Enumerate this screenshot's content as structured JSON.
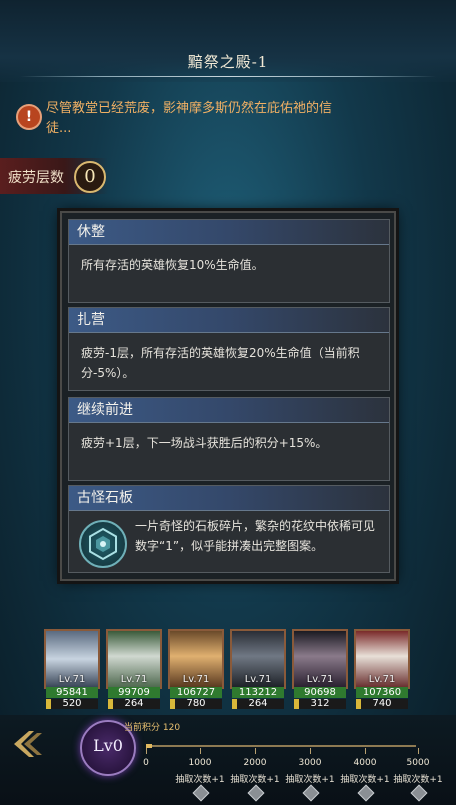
{
  "header": {
    "title": "黯祭之殿-1"
  },
  "notice": {
    "icon": "exclamation-icon",
    "text": "尽管教堂已经荒废，影神摩多斯仍然在庇佑祂的信徒..."
  },
  "fatigue": {
    "label": "疲劳层数",
    "value": "0"
  },
  "options": [
    {
      "title": "休整",
      "desc": "所有存活的英雄恢复10%生命值。"
    },
    {
      "title": "扎营",
      "desc": "疲劳-1层，所有存活的英雄恢复20%生命值（当前积分-5%）。"
    },
    {
      "title": "继续前进",
      "desc": "疲劳+1层，下一场战斗获胜后的积分+15%。"
    },
    {
      "title": "古怪石板",
      "desc": "一片奇怪的石板碎片，繁杂的花纹中依稀可见数字“1”，似乎能拼凑出完整图案。",
      "icon": "hexagon-rune-icon"
    }
  ],
  "heroes": [
    {
      "level": "Lv.71",
      "hp": "95841",
      "energy": "520",
      "energy_fraction": 0.1
    },
    {
      "level": "Lv.71",
      "hp": "99709",
      "energy": "264",
      "energy_fraction": 0.1
    },
    {
      "level": "Lv.71",
      "hp": "106727",
      "energy": "780",
      "energy_fraction": 0.1
    },
    {
      "level": "Lv.71",
      "hp": "113212",
      "energy": "264",
      "energy_fraction": 0.1
    },
    {
      "level": "Lv.71",
      "hp": "90698",
      "energy": "312",
      "energy_fraction": 0.1
    },
    {
      "level": "Lv.71",
      "hp": "107360",
      "energy": "740",
      "energy_fraction": 0.1
    }
  ],
  "progress": {
    "level_badge": "Lv0",
    "score_label": "当前积分 120",
    "score": 120,
    "max_score": 5000,
    "milestones": [
      {
        "value": "0",
        "reward": ""
      },
      {
        "value": "1000",
        "reward": "抽取次数+1"
      },
      {
        "value": "2000",
        "reward": "抽取次数+1"
      },
      {
        "value": "3000",
        "reward": "抽取次数+1"
      },
      {
        "value": "4000",
        "reward": "抽取次数+1"
      },
      {
        "value": "5000",
        "reward": "抽取次数+1"
      }
    ]
  },
  "colors": {
    "accent_gold": "#e0b860",
    "hp_green": "#2f7a2f",
    "warning_orange": "#f0b064"
  }
}
